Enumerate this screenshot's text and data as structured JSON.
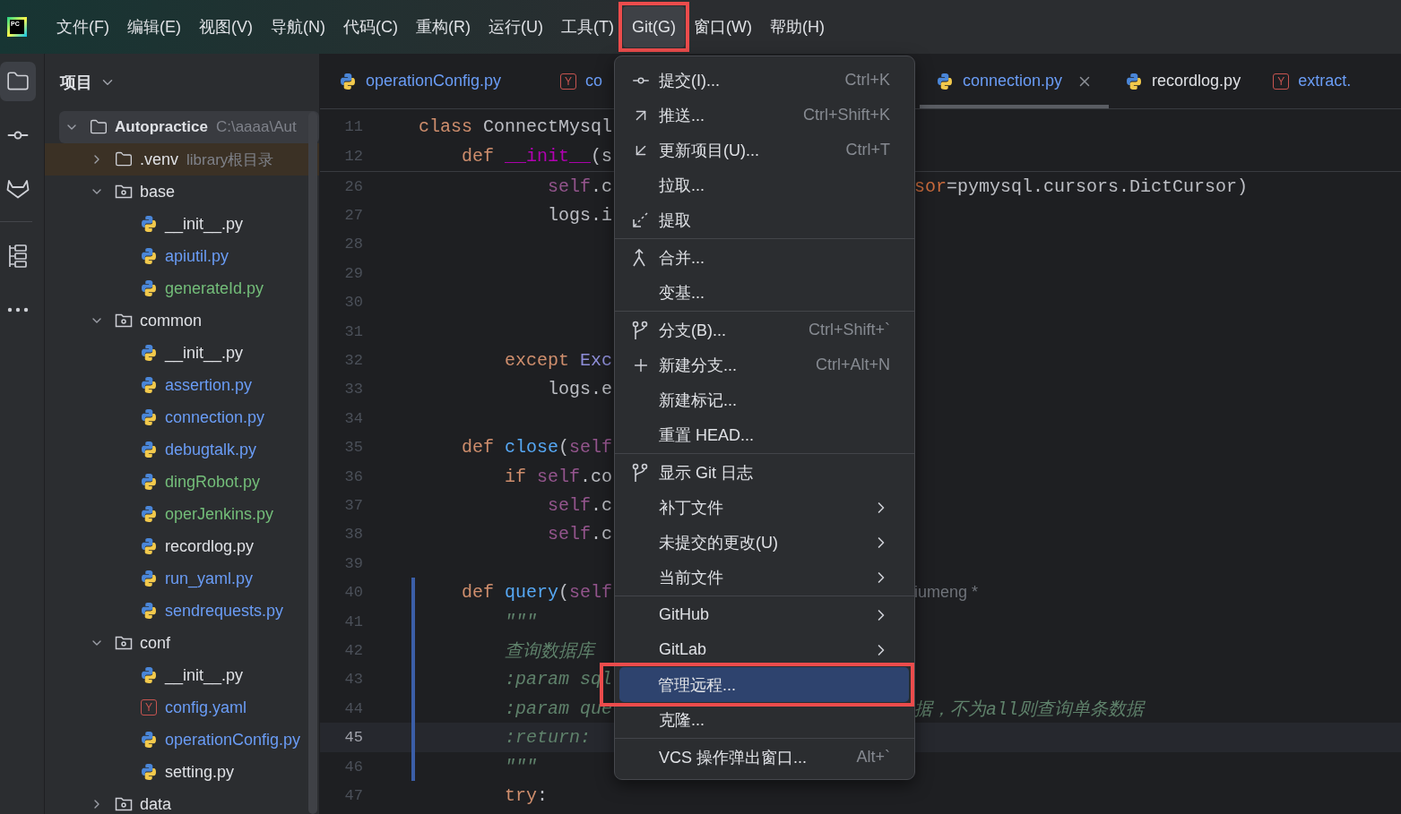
{
  "logo": {
    "text": "PC"
  },
  "menubar": [
    {
      "label": "文件(F)",
      "selected": false,
      "boxed": false
    },
    {
      "label": "编辑(E)",
      "selected": false,
      "boxed": false
    },
    {
      "label": "视图(V)",
      "selected": false,
      "boxed": false
    },
    {
      "label": "导航(N)",
      "selected": false,
      "boxed": false
    },
    {
      "label": "代码(C)",
      "selected": false,
      "boxed": false
    },
    {
      "label": "重构(R)",
      "selected": false,
      "boxed": false
    },
    {
      "label": "运行(U)",
      "selected": false,
      "boxed": false
    },
    {
      "label": "工具(T)",
      "selected": false,
      "boxed": false
    },
    {
      "label": "Git(G)",
      "selected": true,
      "boxed": true
    },
    {
      "label": "窗口(W)",
      "selected": false,
      "boxed": false
    },
    {
      "label": "帮助(H)",
      "selected": false,
      "boxed": false
    }
  ],
  "tool_strip": [
    {
      "kind": "project",
      "selected": true
    },
    {
      "kind": "commit",
      "selected": false
    },
    {
      "kind": "gitlab",
      "selected": false
    },
    {
      "kind": "structure",
      "selected": false
    },
    {
      "kind": "more",
      "selected": false
    }
  ],
  "project_panel": {
    "title": "项目",
    "tree": [
      {
        "label": "Autopractice",
        "hint": "C:\\aaaa\\Aut",
        "kind": "root",
        "expanded": true,
        "selected": true,
        "children": [
          {
            "label": ".venv",
            "hint": "library根目录",
            "kind": "excluded_folder",
            "expanded": false,
            "selected": false
          },
          {
            "label": "base",
            "kind": "package",
            "expanded": true,
            "selected": false,
            "children": [
              {
                "label": "__init__.py",
                "kind": "python",
                "color": "#dfe1e5",
                "selected": false
              },
              {
                "label": "apiutil.py",
                "kind": "python",
                "color": "#6a9cf5",
                "selected": false
              },
              {
                "label": "generateId.py",
                "kind": "python",
                "color": "#73bd79",
                "selected": false
              }
            ]
          },
          {
            "label": "common",
            "kind": "package",
            "expanded": true,
            "selected": false,
            "children": [
              {
                "label": "__init__.py",
                "kind": "python",
                "color": "#dfe1e5",
                "selected": false
              },
              {
                "label": "assertion.py",
                "kind": "python",
                "color": "#6a9cf5",
                "selected": false
              },
              {
                "label": "connection.py",
                "kind": "python",
                "color": "#6a9cf5",
                "selected": false
              },
              {
                "label": "debugtalk.py",
                "kind": "python",
                "color": "#6a9cf5",
                "selected": false
              },
              {
                "label": "dingRobot.py",
                "kind": "python",
                "color": "#73bd79",
                "selected": false
              },
              {
                "label": "operJenkins.py",
                "kind": "python",
                "color": "#73bd79",
                "selected": false
              },
              {
                "label": "recordlog.py",
                "kind": "python",
                "color": "#dfe1e5",
                "selected": false
              },
              {
                "label": "run_yaml.py",
                "kind": "python",
                "color": "#6a9cf5",
                "selected": false
              },
              {
                "label": "sendrequests.py",
                "kind": "python",
                "color": "#6a9cf5",
                "selected": false
              }
            ]
          },
          {
            "label": "conf",
            "kind": "package",
            "expanded": true,
            "selected": false,
            "children": [
              {
                "label": "__init__.py",
                "kind": "python",
                "color": "#dfe1e5",
                "selected": false
              },
              {
                "label": "config.yaml",
                "kind": "yaml",
                "icon_letter": "Y",
                "color": "#6a9cf5",
                "selected": false
              },
              {
                "label": "operationConfig.py",
                "kind": "python",
                "color": "#6a9cf5",
                "selected": false
              },
              {
                "label": "setting.py",
                "kind": "python",
                "color": "#dfe1e5",
                "selected": false
              }
            ]
          },
          {
            "label": "data",
            "kind": "package",
            "expanded": false,
            "selected": false
          }
        ]
      }
    ]
  },
  "editor": {
    "tabs": [
      {
        "label": "operationConfig.py",
        "kind": "python",
        "color": "#6a9cf5",
        "selected": false
      },
      {
        "label": "co",
        "kind": "yaml",
        "icon_letter": "Y",
        "color": "#6a9cf5",
        "selected": false
      },
      {
        "label": "connection.py",
        "kind": "python",
        "color": "#6a9cf5",
        "selected": true
      },
      {
        "label": "recordlog.py",
        "kind": "python",
        "color": "#dfe1e5",
        "selected": false
      },
      {
        "label": "extract.",
        "kind": "yaml",
        "icon_letter": "Y",
        "color": "#6a9cf5",
        "selected": false
      }
    ],
    "sticky_lines": [
      {
        "number": "11",
        "code": [
          {
            "kind": "kw",
            "text": "class"
          },
          {
            "kind": "plain",
            "text": " ConnectMysql"
          }
        ]
      },
      {
        "number": "12",
        "code": [
          {
            "kind": "kw",
            "text": "    def"
          },
          {
            "kind": "magic",
            "text": " __init__"
          },
          {
            "kind": "plain",
            "text": "(s"
          }
        ]
      }
    ],
    "lines": [
      {
        "number": "26",
        "changed": false,
        "current": false,
        "code": [
          {
            "kind": "self",
            "text": "            self"
          },
          {
            "kind": "plain",
            "text": ".c"
          }
        ],
        "trailing": [
          {
            "kind": "named",
            "text": "sor"
          },
          {
            "kind": "plain",
            "text": "=pymysql.cursors.DictCursor)"
          }
        ]
      },
      {
        "number": "27",
        "changed": false,
        "current": false,
        "code": [
          {
            "kind": "plain",
            "text": "            logs.i"
          }
        ]
      },
      {
        "number": "28",
        "changed": false,
        "current": false
      },
      {
        "number": "29",
        "changed": false,
        "current": false
      },
      {
        "number": "30",
        "changed": false,
        "current": false
      },
      {
        "number": "31",
        "changed": false,
        "current": false
      },
      {
        "number": "32",
        "changed": false,
        "current": false,
        "code": [
          {
            "kind": "kw",
            "text": "        except"
          },
          {
            "kind": "cls",
            "text": " Exc"
          }
        ]
      },
      {
        "number": "33",
        "changed": false,
        "current": false,
        "code": [
          {
            "kind": "plain",
            "text": "            logs.e"
          }
        ]
      },
      {
        "number": "34",
        "changed": false,
        "current": false
      },
      {
        "number": "35",
        "changed": false,
        "current": false,
        "code": [
          {
            "kind": "kw",
            "text": "    def"
          },
          {
            "kind": "fn",
            "text": " close"
          },
          {
            "kind": "plain",
            "text": "("
          },
          {
            "kind": "self",
            "text": "self"
          }
        ]
      },
      {
        "number": "36",
        "changed": false,
        "current": false,
        "code": [
          {
            "kind": "kw",
            "text": "        if"
          },
          {
            "kind": "self",
            "text": " self"
          },
          {
            "kind": "plain",
            "text": ".co"
          }
        ]
      },
      {
        "number": "37",
        "changed": false,
        "current": false,
        "code": [
          {
            "kind": "self",
            "text": "            self"
          },
          {
            "kind": "plain",
            "text": ".c"
          }
        ]
      },
      {
        "number": "38",
        "changed": false,
        "current": false,
        "code": [
          {
            "kind": "self",
            "text": "            self"
          },
          {
            "kind": "plain",
            "text": ".c"
          }
        ]
      },
      {
        "number": "39",
        "changed": false,
        "current": false
      },
      {
        "number": "40",
        "changed": true,
        "current": false,
        "code": [
          {
            "kind": "kw",
            "text": "    def"
          },
          {
            "kind": "fn",
            "text": " query"
          },
          {
            "kind": "plain",
            "text": "("
          },
          {
            "kind": "self",
            "text": "self"
          }
        ],
        "trailing": [
          {
            "kind": "hint",
            "text": "iumeng *"
          }
        ]
      },
      {
        "number": "41",
        "changed": true,
        "current": false,
        "code": [
          {
            "kind": "doc",
            "text": "        \"\"\""
          }
        ]
      },
      {
        "number": "42",
        "changed": true,
        "current": false,
        "code": [
          {
            "kind": "doc",
            "text": "        查询数据库"
          }
        ]
      },
      {
        "number": "43",
        "changed": true,
        "current": false,
        "code": [
          {
            "kind": "doc",
            "text": "        :param sql"
          }
        ]
      },
      {
        "number": "44",
        "changed": true,
        "current": false,
        "code": [
          {
            "kind": "doc",
            "text": "        :param que"
          }
        ],
        "trailing": [
          {
            "kind": "doc",
            "text": "据，不为all则查询单条数据"
          }
        ]
      },
      {
        "number": "45",
        "changed": true,
        "current": true,
        "code": [
          {
            "kind": "doc",
            "text": "        :return:"
          }
        ]
      },
      {
        "number": "46",
        "changed": true,
        "current": false,
        "code": [
          {
            "kind": "doc",
            "text": "        \"\"\""
          }
        ]
      },
      {
        "number": "47",
        "changed": false,
        "current": false,
        "code": [
          {
            "kind": "kw",
            "text": "        try"
          },
          {
            "kind": "plain",
            "text": ":"
          }
        ]
      }
    ]
  },
  "git_menu": {
    "sections": [
      {
        "items": [
          {
            "label": "提交(I)...",
            "kind": "commit",
            "shortcut": "Ctrl+K",
            "submenu": false,
            "selected": false,
            "boxed": false
          },
          {
            "label": "推送...",
            "kind": "push",
            "shortcut": "Ctrl+Shift+K",
            "submenu": false,
            "selected": false,
            "boxed": false
          },
          {
            "label": "更新项目(U)...",
            "kind": "update",
            "shortcut": "Ctrl+T",
            "submenu": false,
            "selected": false,
            "boxed": false
          },
          {
            "label": "拉取...",
            "kind": "plain",
            "submenu": false,
            "selected": false,
            "boxed": false
          },
          {
            "label": "提取",
            "kind": "fetch",
            "submenu": false,
            "selected": false,
            "boxed": false
          }
        ]
      },
      {
        "items": [
          {
            "label": "合并...",
            "kind": "merge",
            "submenu": false,
            "selected": false,
            "boxed": false
          },
          {
            "label": "变基...",
            "kind": "plain",
            "submenu": false,
            "selected": false,
            "boxed": false
          }
        ]
      },
      {
        "items": [
          {
            "label": "分支(B)...",
            "kind": "branch",
            "shortcut": "Ctrl+Shift+`",
            "submenu": false,
            "selected": false,
            "boxed": false
          },
          {
            "label": "新建分支...",
            "kind": "new",
            "shortcut": "Ctrl+Alt+N",
            "submenu": false,
            "selected": false,
            "boxed": false
          },
          {
            "label": "新建标记...",
            "kind": "plain",
            "submenu": false,
            "selected": false,
            "boxed": false
          },
          {
            "label": "重置 HEAD...",
            "kind": "plain",
            "submenu": false,
            "selected": false,
            "boxed": false
          }
        ]
      },
      {
        "items": [
          {
            "label": "显示 Git 日志",
            "kind": "log",
            "submenu": false,
            "selected": false,
            "boxed": false
          },
          {
            "label": "补丁文件",
            "kind": "plain",
            "submenu": true,
            "selected": false,
            "boxed": false
          },
          {
            "label": "未提交的更改(U)",
            "kind": "plain",
            "submenu": true,
            "selected": false,
            "boxed": false
          },
          {
            "label": "当前文件",
            "kind": "plain",
            "submenu": true,
            "selected": false,
            "boxed": false
          }
        ]
      },
      {
        "items": [
          {
            "label": "GitHub",
            "kind": "plain",
            "submenu": true,
            "selected": false,
            "boxed": false
          },
          {
            "label": "GitLab",
            "kind": "plain",
            "submenu": true,
            "selected": false,
            "boxed": false
          },
          {
            "label": "管理远程...",
            "kind": "plain",
            "submenu": false,
            "selected": true,
            "boxed": true
          },
          {
            "label": "克隆...",
            "kind": "plain",
            "submenu": false,
            "selected": false,
            "boxed": false
          }
        ]
      },
      {
        "items": [
          {
            "label": "VCS 操作弹出窗口...",
            "kind": "plain",
            "shortcut": "Alt+`",
            "submenu": false,
            "selected": false,
            "boxed": false
          }
        ]
      }
    ]
  }
}
